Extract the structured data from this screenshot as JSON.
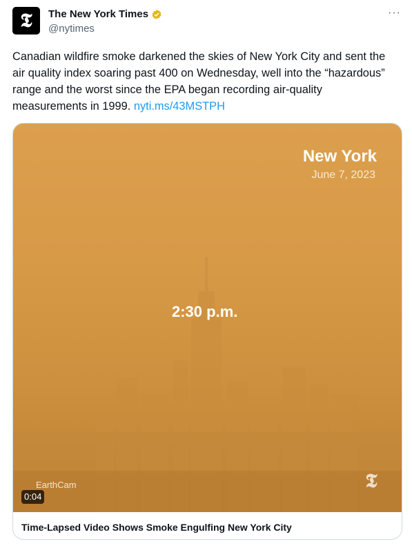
{
  "author": {
    "name": "The New York Times",
    "handle": "@nytimes",
    "avatar_glyph": "𝕿",
    "verified_color": "#e2b719"
  },
  "menu": {
    "more_label": "···"
  },
  "tweet": {
    "text": "Canadian wildfire smoke darkened the skies of New York City and sent the air quality index soaring past 400 on Wednesday, well into the “hazardous” range and the worst since the EPA began recording air-quality measurements in 1999. ",
    "link_text": "nyti.ms/43MSTPH",
    "link_color": "#1d9bf0"
  },
  "media": {
    "city_label": "New York",
    "date_label": "June 7, 2023",
    "time_label": "2:30 p.m.",
    "credit": "EarthCam",
    "duration": "0:04",
    "logo_glyph": "𝕿"
  },
  "card": {
    "title": "Time-Lapsed Video Shows Smoke Engulfing New York City"
  }
}
